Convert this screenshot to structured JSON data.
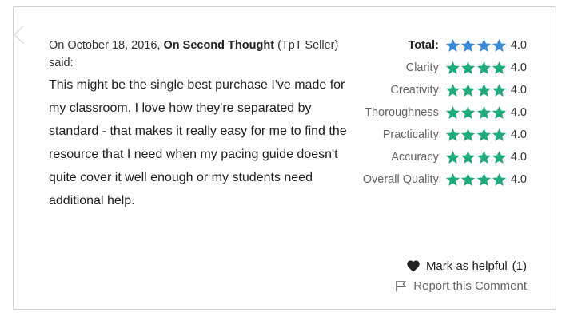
{
  "comment": {
    "date_prefix": "On October 18, 2016,",
    "author": "On Second Thought",
    "author_suffix": "(TpT Seller) said:",
    "text": "This might be the single best purchase I've made for my classroom.  I love how they're separated by standard - that makes it really easy for me to find the resource that I need when my pacing guide doesn't quite cover it well enough or my students need additional help."
  },
  "ratings": [
    {
      "label": "Total:",
      "stars": 4,
      "value": "4.0",
      "color": "#3a8ad6"
    },
    {
      "label": "Clarity",
      "stars": 4,
      "value": "4.0",
      "color": "#1fab7c"
    },
    {
      "label": "Creativity",
      "stars": 4,
      "value": "4.0",
      "color": "#1fab7c"
    },
    {
      "label": "Thoroughness",
      "stars": 4,
      "value": "4.0",
      "color": "#1fab7c"
    },
    {
      "label": "Practicality",
      "stars": 4,
      "value": "4.0",
      "color": "#1fab7c"
    },
    {
      "label": "Accuracy",
      "stars": 4,
      "value": "4.0",
      "color": "#1fab7c"
    },
    {
      "label": "Overall Quality",
      "stars": 4,
      "value": "4.0",
      "color": "#1fab7c"
    }
  ],
  "actions": {
    "helpful_label": "Mark as helpful",
    "helpful_count": "(1)",
    "report_label": "Report this Comment"
  }
}
